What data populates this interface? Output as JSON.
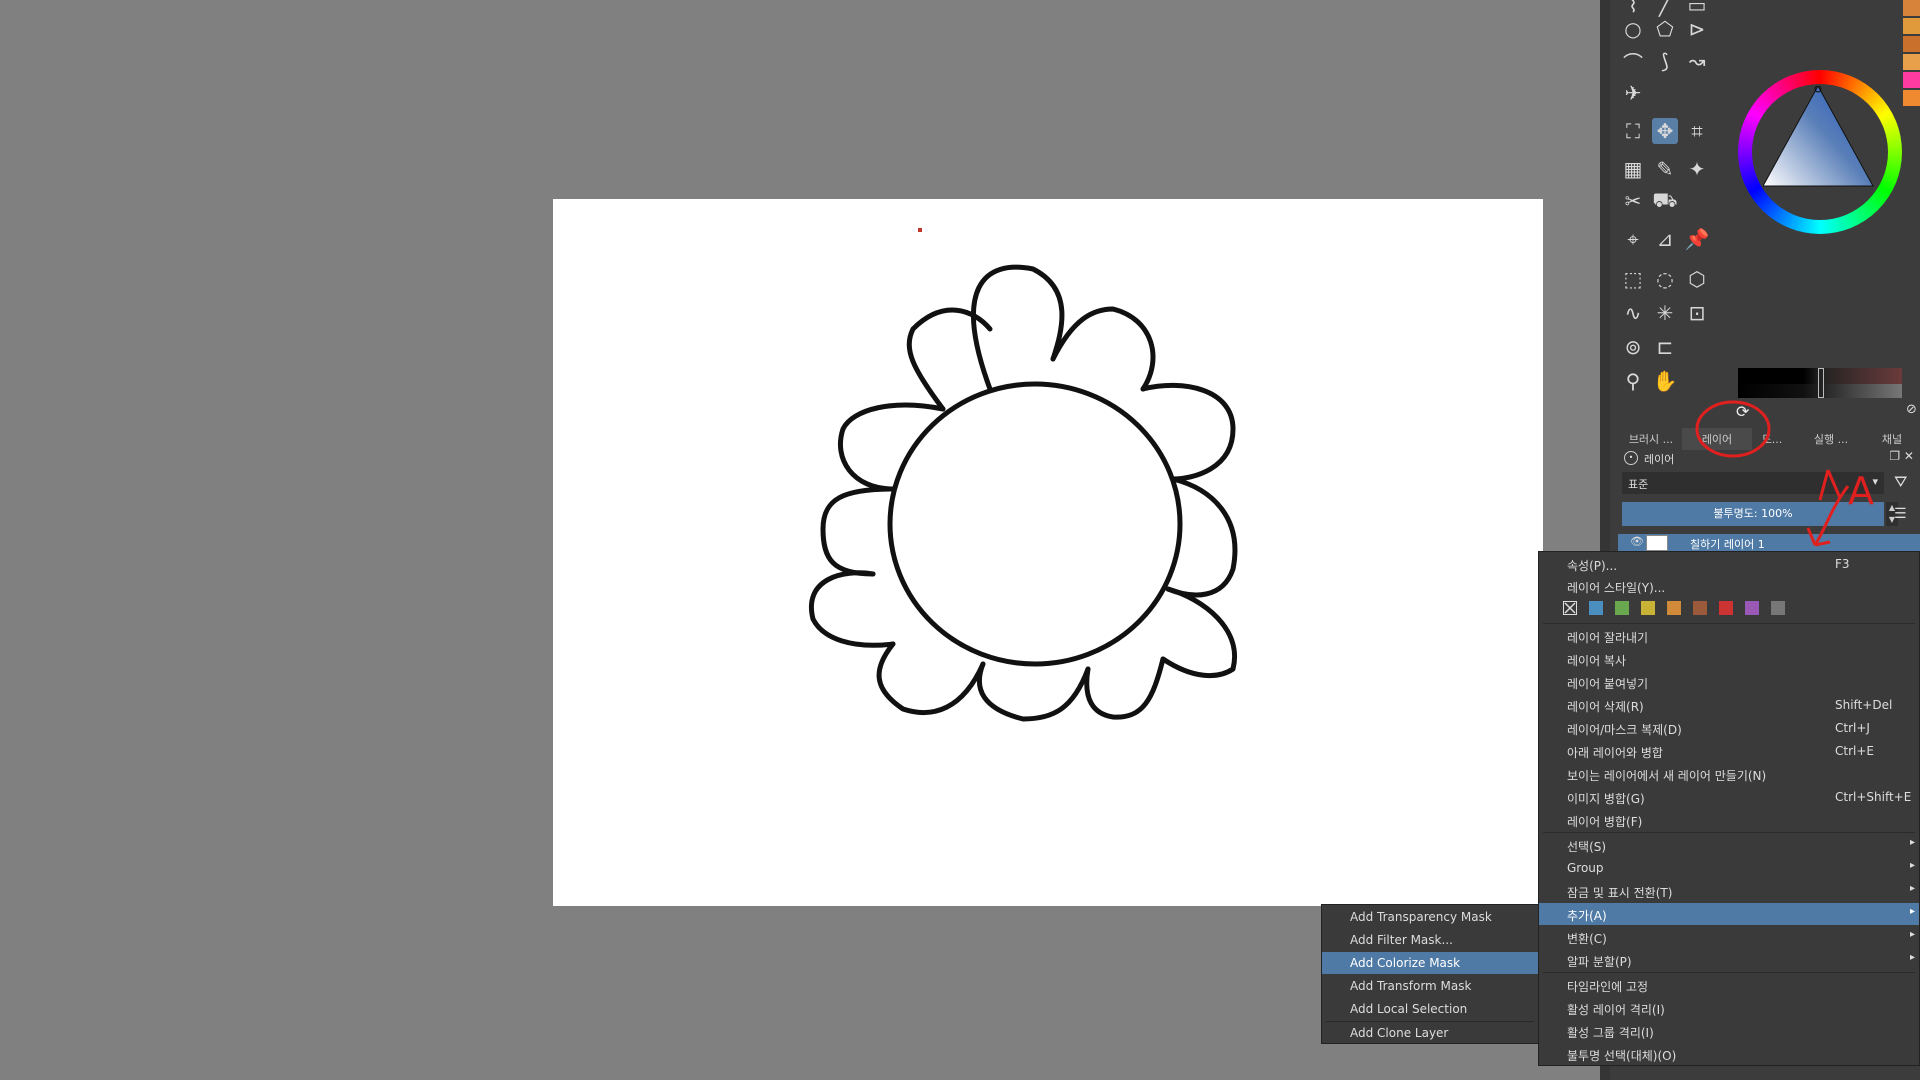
{
  "icons": {
    "tools": [
      "freehand-path-icon",
      "line-icon",
      "rectangle-icon",
      "ellipse-icon",
      "polygon-icon",
      "polyline-icon",
      "bezier-icon",
      "dynamic-brush-icon",
      "multibrush-icon",
      "assistant-icon",
      "transform-icon",
      "move-icon",
      "crop-icon",
      "gradient-icon",
      "color-picker-icon",
      "smart-patch-icon",
      "measure-icon",
      "fill-icon",
      "perspective-icon",
      "ruler-icon",
      "pin-icon",
      "rect-select-icon",
      "ellipse-select-icon",
      "polygon-select-icon",
      "freehand-select-icon",
      "magic-wand-icon",
      "similar-select-icon",
      "bezier-select-icon",
      "magnetic-select-icon",
      "zoom-icon",
      "pan-icon"
    ]
  },
  "colors": {
    "accent": "#4f7aa6",
    "swatches": [
      "#d8833a",
      "#e09a3c",
      "#c8702c",
      "#e8a04a",
      "#ff3aa0",
      "#f08a30"
    ],
    "layer_colors": [
      "#4a8fc0",
      "#6aa84f",
      "#c9b236",
      "#d08a3a",
      "#9b5a3c",
      "#cc3333",
      "#9b59b6",
      "#777777"
    ]
  },
  "dock": {
    "tabs": [
      "브러시 ...",
      "레이어",
      "도...",
      "실행 ...",
      "채널"
    ],
    "panel_title": "레이어",
    "blend_mode": "표준",
    "opacity_label": "불투명도:  100%",
    "layer_name": "칠하기 레이어 1"
  },
  "context_menu": {
    "properties": "속성(P)...",
    "properties_sc": "F3",
    "layer_style": "레이어 스타일(Y)...",
    "cut": "레이어 잘라내기",
    "copy": "레이어 복사",
    "paste": "레이어 붙여넣기",
    "delete": "레이어 삭제(R)",
    "delete_sc": "Shift+Del",
    "duplicate": "레이어/마스크 복제(D)",
    "duplicate_sc": "Ctrl+J",
    "merge_down": "아래 레이어와 병합",
    "merge_down_sc": "Ctrl+E",
    "new_from_visible": "보이는 레이어에서 새 레이어 만들기(N)",
    "flatten_image": "이미지 병합(G)",
    "flatten_image_sc": "Ctrl+Shift+E",
    "flatten_layer": "레이어 병합(F)",
    "select": "선택(S)",
    "group": "Group",
    "lock_toggle": "잠금 및 표시 전환(T)",
    "add": "추가(A)",
    "convert": "변환(C)",
    "split_alpha": "알파 분할(P)",
    "pin_timeline": "타임라인에 고정",
    "isolate_layer": "활성 레이어 격리(I)",
    "isolate_group": "활성 그룹 격리(I)",
    "select_opaque": "불투명 선택(대체)(O)"
  },
  "submenu": {
    "transparency_mask": "Add Transparency Mask",
    "filter_mask": "Add Filter Mask...",
    "colorize_mask": "Add Colorize Mask",
    "transform_mask": "Add Transform Mask",
    "local_selection": "Add Local Selection",
    "clone_layer": "Add Clone Layer"
  },
  "annotation": {
    "letter": "A"
  }
}
